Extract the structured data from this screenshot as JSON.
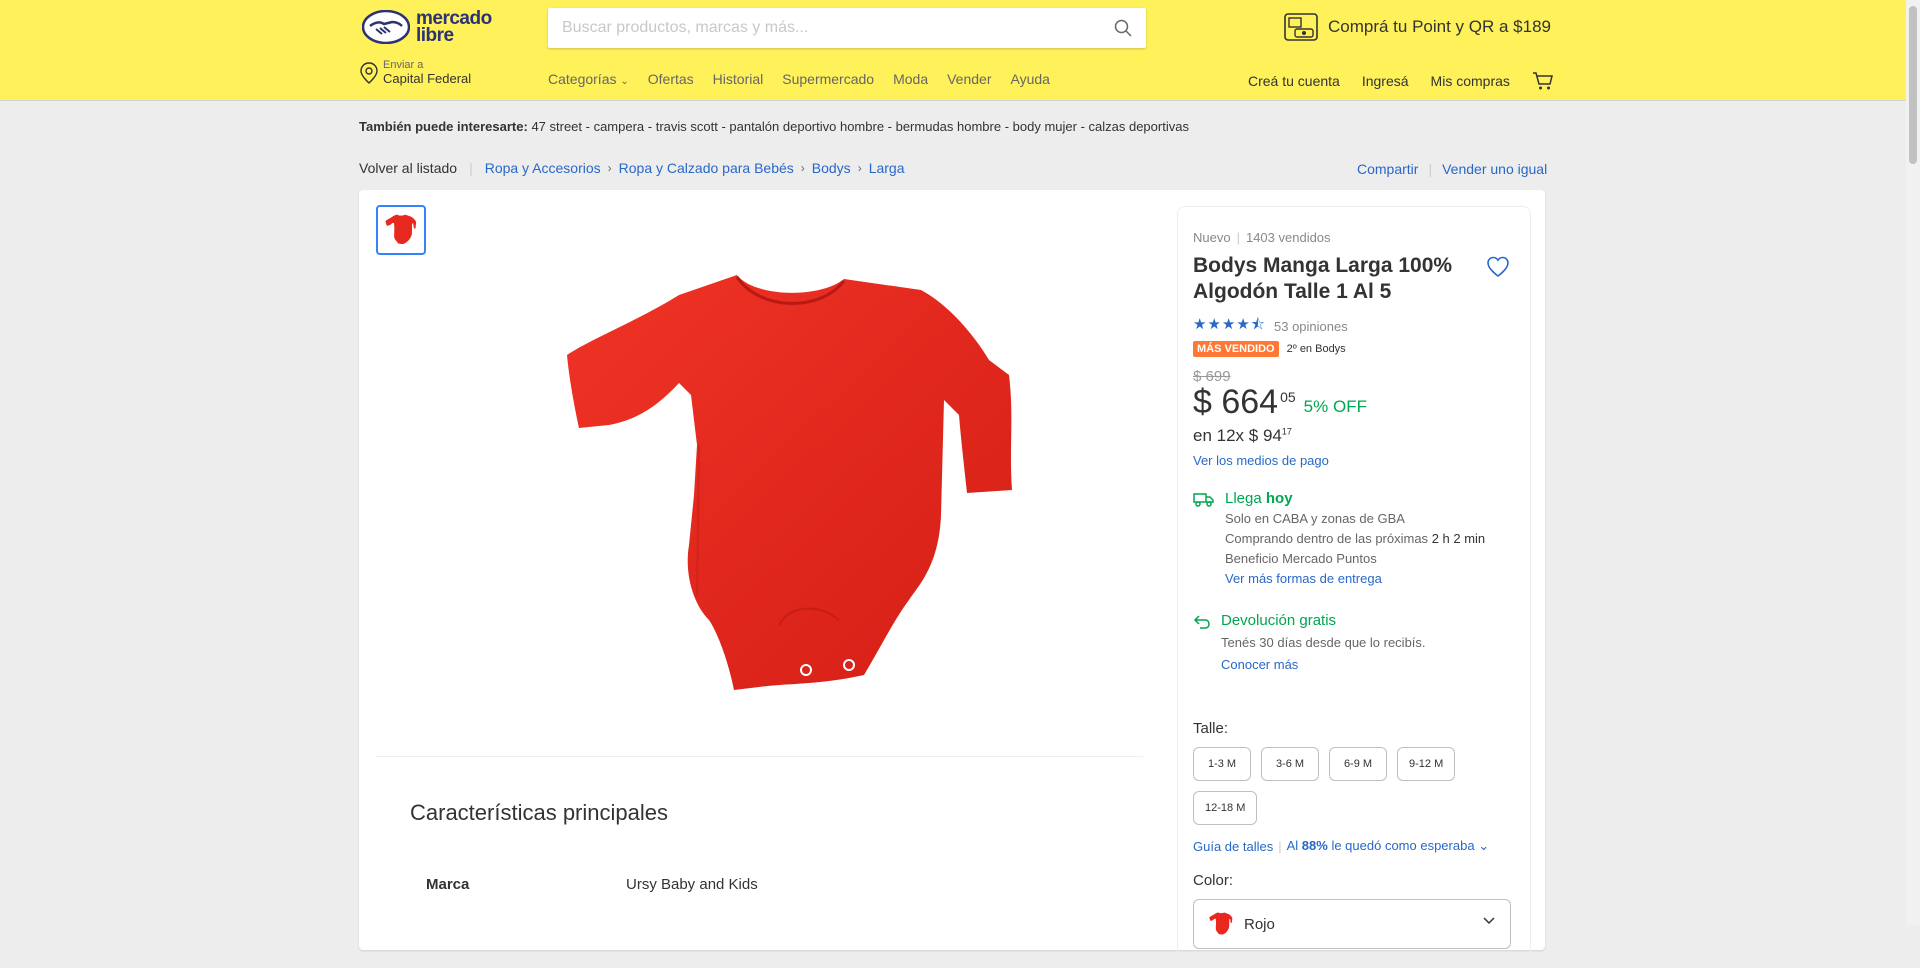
{
  "header": {
    "logo_text_1": "mercado",
    "logo_text_2": "libre",
    "search_placeholder": "Buscar productos, marcas y más...",
    "promo": "Comprá tu Point y QR a $189",
    "location_label": "Enviar a",
    "location_value": "Capital Federal",
    "nav": [
      "Categorías",
      "Ofertas",
      "Historial",
      "Supermercado",
      "Moda",
      "Vender",
      "Ayuda"
    ],
    "user_nav": [
      "Creá tu cuenta",
      "Ingresá",
      "Mis compras"
    ]
  },
  "suggest": {
    "label": "También puede interesarte:",
    "items": "47 street - campera - travis scott - pantalón deportivo hombre - bermudas hombre - body mujer - calzas deportivas"
  },
  "breadcrumb": {
    "back": "Volver al listado",
    "items": [
      "Ropa y Accesorios",
      "Ropa y Calzado para Bebés",
      "Bodys",
      "Larga"
    ],
    "share": "Compartir",
    "sell_same": "Vender uno igual"
  },
  "product": {
    "condition": "Nuevo",
    "sold": "1403 vendidos",
    "title": "Bodys Manga Larga 100% Algodón Talle 1 Al 5",
    "rating_value": 4.5,
    "reviews": "53 opiniones",
    "badge": "MÁS VENDIDO",
    "rank": "2º en Bodys",
    "old_price": "$ 699",
    "price": "$ 664",
    "price_cents": "05",
    "discount": "5% OFF",
    "installments_prefix": "en 12x $ 94",
    "installments_cents": "17",
    "payment_link": "Ver los medios de pago",
    "color_product": "#e8281f"
  },
  "shipping": {
    "title_prefix": "Llega",
    "title_bold": "hoy",
    "line1": "Solo en CABA y zonas de GBA",
    "line2_prefix": "Comprando dentro de las próximas",
    "line2_time": "2 h 2 min",
    "line3": "Beneficio Mercado Puntos",
    "link": "Ver más formas de entrega"
  },
  "returns": {
    "title": "Devolución gratis",
    "line": "Tenés 30 días desde que lo recibís.",
    "link": "Conocer más"
  },
  "sizes": {
    "label": "Talle:",
    "options": [
      "1-3 M",
      "3-6 M",
      "6-9 M",
      "9-12 M",
      "12-18 M"
    ],
    "guide": "Guía de talles",
    "fit_prefix": "Al",
    "fit_pct": "88%",
    "fit_suffix": "le quedó como esperaba"
  },
  "color": {
    "label": "Color:",
    "selected": "Rojo"
  },
  "features": {
    "title": "Características principales",
    "rows": [
      {
        "key": "Marca",
        "value": "Ursy Baby and Kids"
      }
    ]
  },
  "colors": {
    "header_bg": "#fff159",
    "link": "#2968c8",
    "green": "#00a650",
    "badge": "#ff7733"
  }
}
